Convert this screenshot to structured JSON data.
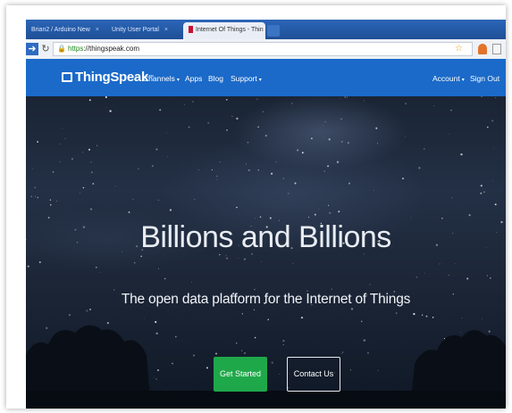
{
  "browser": {
    "tabs": [
      {
        "label": "Brian2 / Arduino New",
        "close": "×"
      },
      {
        "label": "Unity User Portal",
        "close": "×"
      },
      {
        "label": "Internet Of Things - Thin",
        "close": "×",
        "active": true
      }
    ],
    "url": {
      "scheme": "https",
      "rest": "://thingspeak.com"
    },
    "icons": {
      "back": "back-arrow-icon",
      "reload": "reload-icon",
      "lock": "lock-icon",
      "star": "bookmark-star-icon"
    }
  },
  "site": {
    "brand": "ThingSpeak",
    "brand_tm": "™",
    "menu_left": [
      {
        "label": "Channels",
        "dropdown": true
      },
      {
        "label": "Apps",
        "dropdown": false
      },
      {
        "label": "Blog",
        "dropdown": false
      },
      {
        "label": "Support",
        "dropdown": true
      }
    ],
    "menu_right": [
      {
        "label": "Account",
        "dropdown": true
      },
      {
        "label": "Sign Out",
        "dropdown": false
      }
    ],
    "caret": "▾"
  },
  "hero": {
    "title": "Billions and Billions",
    "subtitle": "The open data platform for the Internet of Things",
    "primary_button": "Get Started",
    "secondary_button": "Contact Us"
  },
  "colors": {
    "navbar": "#1b6ac9",
    "primary_button": "#1fa84a",
    "tabbar": "#2b66b8"
  }
}
